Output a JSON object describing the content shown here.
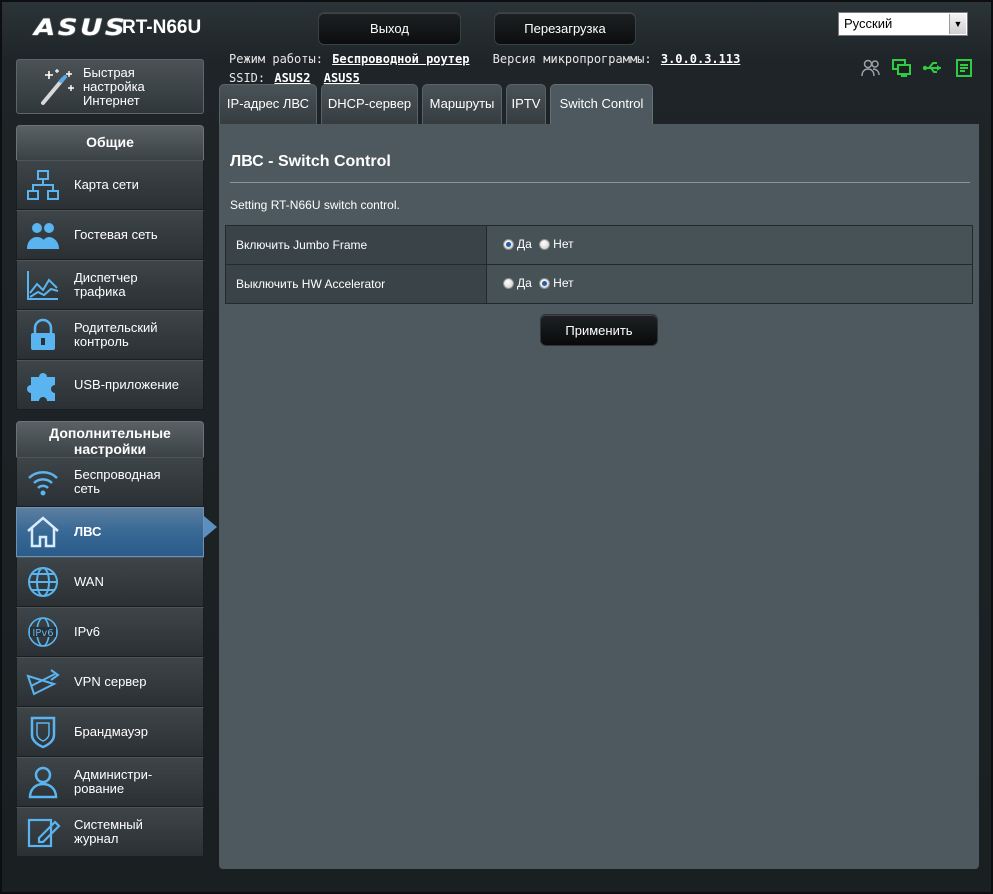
{
  "header": {
    "brand": "ASUS",
    "model": "RT-N66U",
    "logout_label": "Выход",
    "reboot_label": "Перезагрузка",
    "language": "Русский"
  },
  "info": {
    "mode_label": "Режим работы:",
    "mode_value": "Беспроводной роутер",
    "firmware_label": "Версия микропрограммы:",
    "firmware_value": "3.0.0.3.113",
    "ssid_label": "SSID:",
    "ssid_values": [
      "ASUS2",
      "ASUS5"
    ]
  },
  "quick_setup": {
    "label": "Быстрая настройка Интернет"
  },
  "sidebar": {
    "general_title": "Общие",
    "general_items": [
      {
        "label": "Карта сети",
        "icon": "network-map-icon"
      },
      {
        "label": "Гостевая сеть",
        "icon": "guest-network-icon"
      },
      {
        "label": "Диспетчер трафика",
        "icon": "traffic-manager-icon"
      },
      {
        "label": "Родительский контроль",
        "icon": "lock-icon"
      },
      {
        "label": "USB-приложение",
        "icon": "puzzle-icon"
      }
    ],
    "advanced_title": "Дополнительные настройки",
    "advanced_items": [
      {
        "label": "Беспроводная сеть",
        "icon": "wifi-icon"
      },
      {
        "label": "ЛВС",
        "icon": "home-icon",
        "active": true
      },
      {
        "label": "WAN",
        "icon": "globe-icon"
      },
      {
        "label": "IPv6",
        "icon": "ipv6-globe-icon"
      },
      {
        "label": "VPN сервер",
        "icon": "vpn-icon"
      },
      {
        "label": "Брандмауэр",
        "icon": "shield-icon"
      },
      {
        "label": "Администри-рование",
        "icon": "admin-user-icon"
      },
      {
        "label": "Системный журнал",
        "icon": "log-edit-icon"
      }
    ]
  },
  "tabs": [
    {
      "label": "IP-адрес ЛВС"
    },
    {
      "label": "DHCP-сервер"
    },
    {
      "label": "Маршруты"
    },
    {
      "label": "IPTV"
    },
    {
      "label": "Switch Control",
      "active": true
    }
  ],
  "content": {
    "title": "ЛВС - Switch Control",
    "description": "Setting RT-N66U switch control.",
    "rows": [
      {
        "label": "Включить Jumbo Frame",
        "yes": "Да",
        "no": "Нет",
        "selected": "yes"
      },
      {
        "label": "Выключить HW Accelerator",
        "yes": "Да",
        "no": "Нет",
        "selected": "no"
      }
    ],
    "apply_label": "Применить"
  },
  "colors": {
    "panel_bg": "#4d595e",
    "active_nav": "#3a6a96",
    "status_green": "#2ecc40"
  }
}
